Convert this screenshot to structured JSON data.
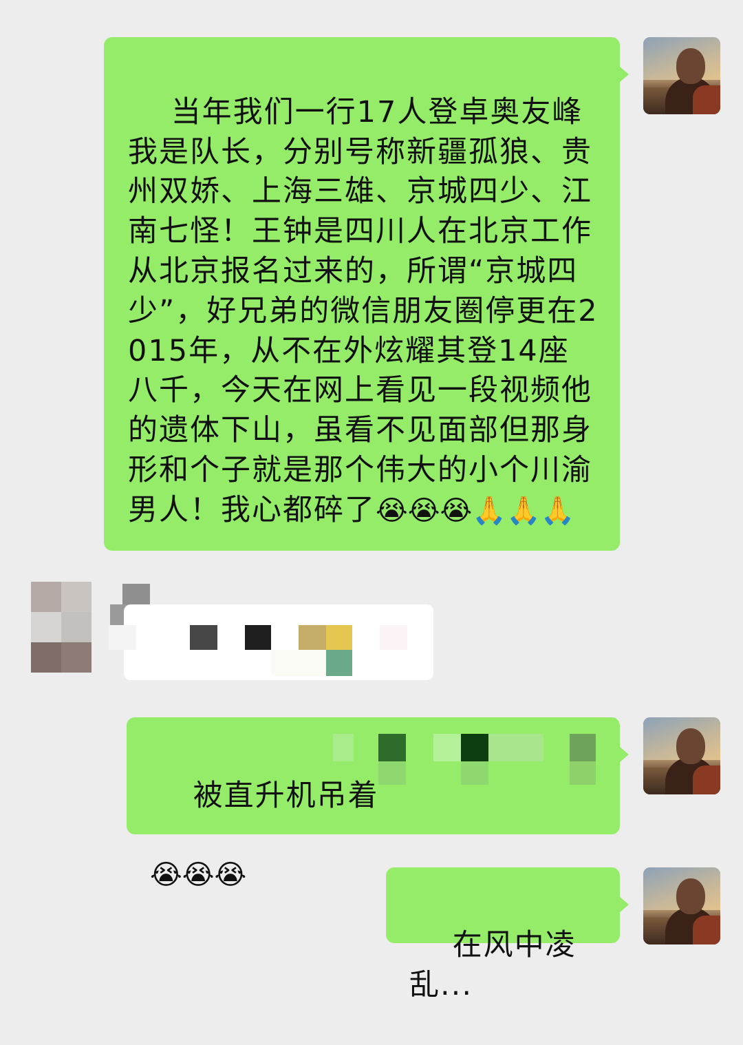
{
  "messages": [
    {
      "sender": "self",
      "text": "当年我们一行17人登卓奥友峰我是队长，分别号称新疆孤狼、贵州双娇、上海三雄、京城四少、江南七怪！王钟是四川人在北京工作从北京报名过来的，所谓“京城四少”，好兄弟的微信朋友圈停更在2015年，从不在外炫耀其登14座八千，今天在网上看见一段视频他的遗体下山，虽看不见面部但那身形和个子就是那个伟大的小个川渝男人！我心都碎了",
      "emojis": "😭😭😭🙏🙏🙏"
    },
    {
      "sender": "other",
      "text": ""
    },
    {
      "sender": "self",
      "text": "被直升机吊着",
      "emojis": "😭😭😭"
    },
    {
      "sender": "self",
      "text": "在风中凌乱...",
      "emojis": ""
    }
  ],
  "colors": {
    "background": "#ededed",
    "self_bubble": "#95ec69",
    "other_bubble": "#ffffff"
  },
  "icons": {
    "avatar": "user-avatar-photo"
  }
}
